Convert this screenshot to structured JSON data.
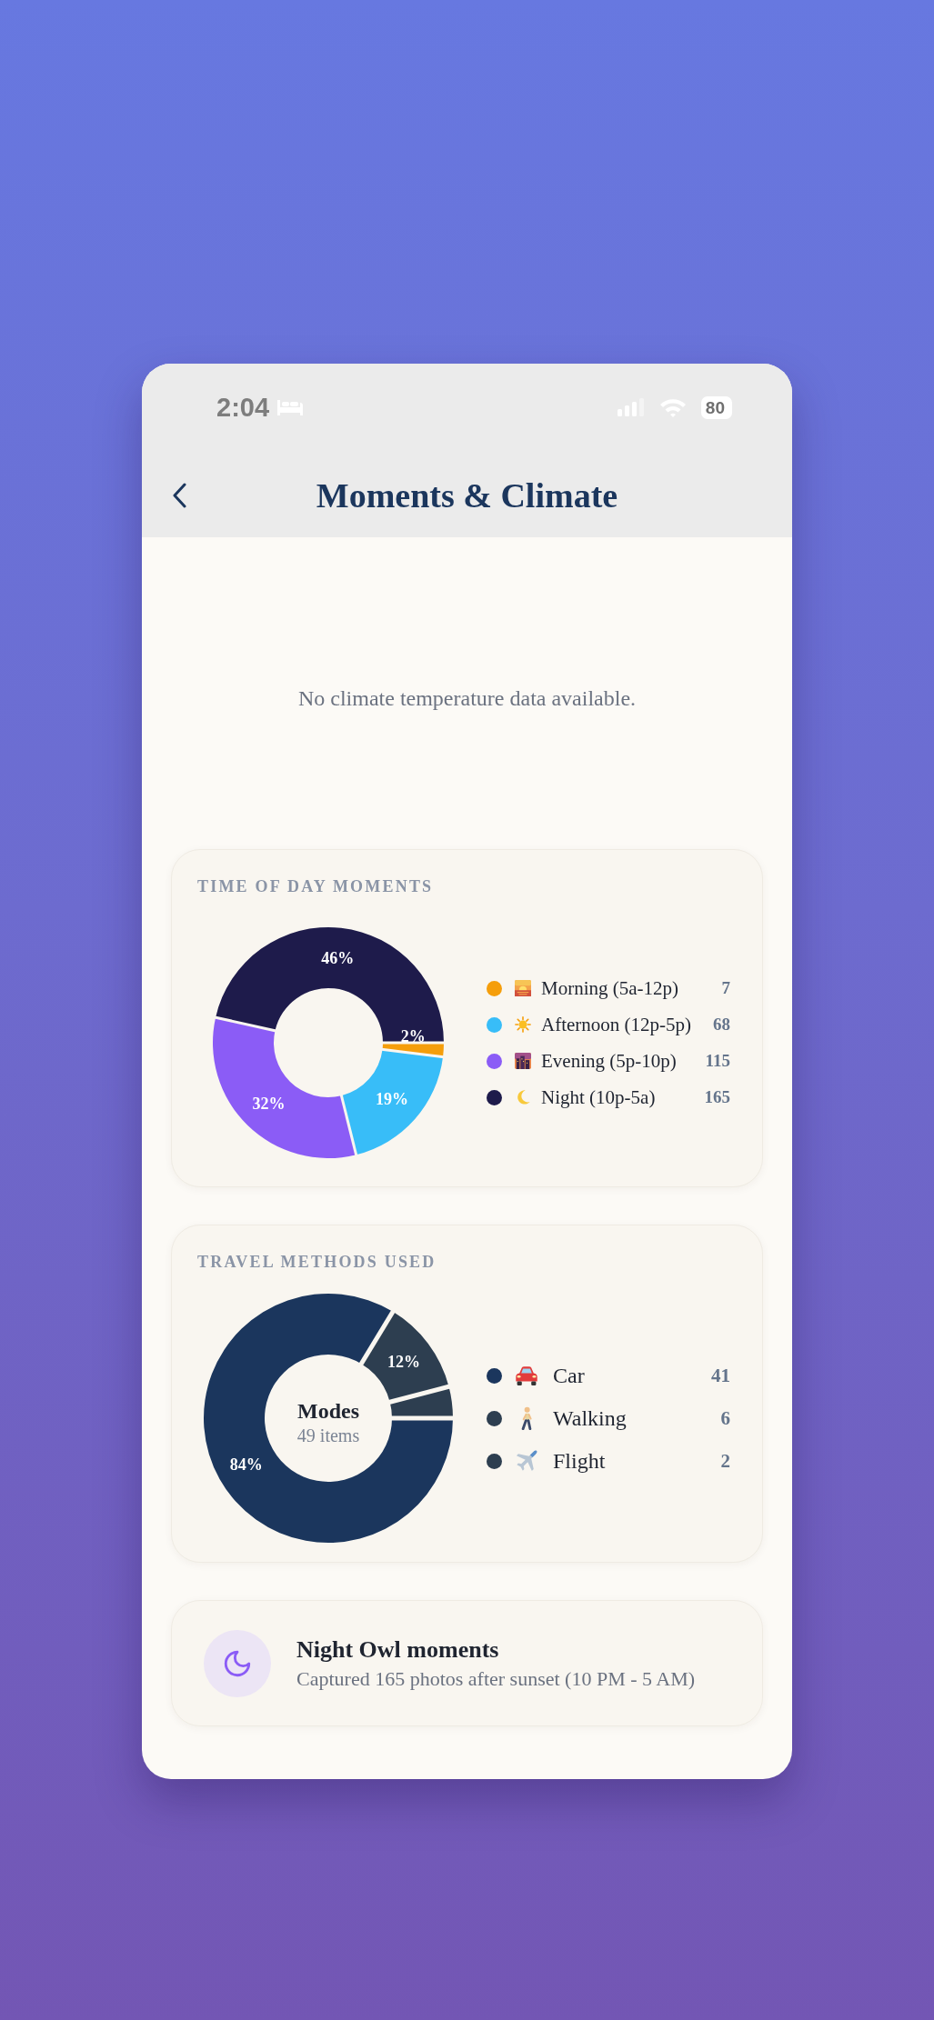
{
  "status_bar": {
    "time": "2:04",
    "battery": "80"
  },
  "header": {
    "title": "Moments & Climate"
  },
  "empty_state": {
    "message": "No climate temperature data available."
  },
  "time_of_day": {
    "title": "TIME OF DAY MOMENTS",
    "chart_data": {
      "type": "donut",
      "categories": [
        "Morning (5a-12p)",
        "Afternoon (12p-5p)",
        "Evening (5p-10p)",
        "Night (10p-5a)"
      ],
      "values": [
        1.97,
        19.16,
        32.39,
        46.48
      ],
      "value_labels": [
        "2%",
        "19%",
        "32%",
        "46%"
      ]
    },
    "legend": [
      {
        "kind": "sunrise",
        "color": "#f59e0b",
        "count": "7"
      },
      {
        "kind": "sun",
        "color": "#38bdf8",
        "count": "68"
      },
      {
        "kind": "dusk",
        "color": "#8b5cf6",
        "count": "115"
      },
      {
        "kind": "moon",
        "color": "#1e1b4b",
        "count": "165"
      }
    ]
  },
  "travel_methods": {
    "title": "TRAVEL METHODS USED",
    "center_title": "Modes",
    "center_subtitle": "49 items",
    "chart_data": {
      "type": "donut",
      "categories": [
        "Car",
        "Walking",
        "Flight"
      ],
      "values": [
        83.67,
        12.25,
        4.08
      ],
      "value_labels": [
        "84%",
        "12%",
        null
      ]
    },
    "legend": [
      {
        "kind": "car",
        "color": "#1b365d",
        "count": "41"
      },
      {
        "kind": "walking",
        "color": "#2d3e50",
        "count": "6"
      },
      {
        "kind": "flight",
        "color": "#2d3e50",
        "count": "2"
      }
    ]
  },
  "highlight": {
    "title": "Night Owl moments",
    "description": "Captured 165 photos after sunset (10 PM - 5 AM)"
  }
}
